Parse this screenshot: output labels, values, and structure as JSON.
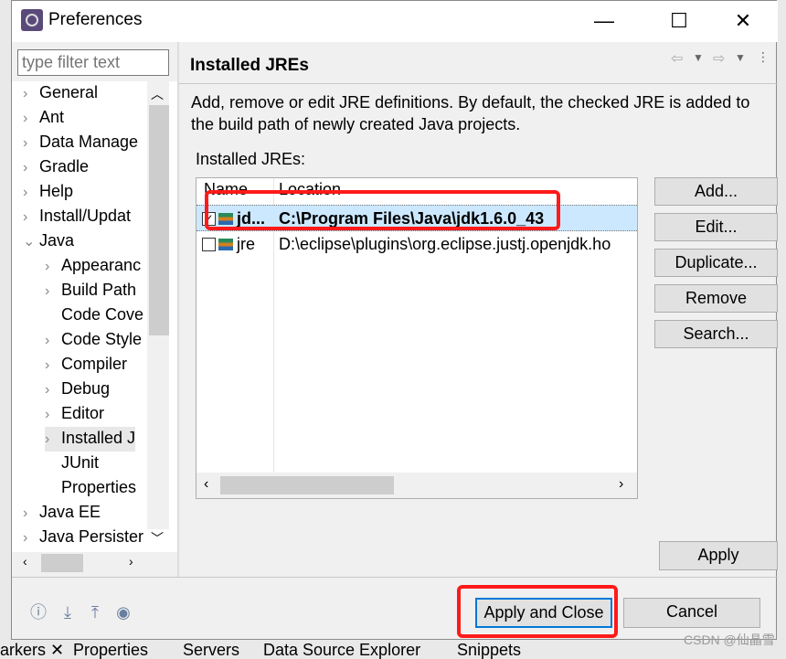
{
  "window": {
    "title": "Preferences",
    "minimize": "—",
    "maximize": "☐",
    "close": "✕"
  },
  "filter": {
    "placeholder": "type filter text"
  },
  "tree": [
    {
      "label": "General",
      "level": 0,
      "expander": "›"
    },
    {
      "label": "Ant",
      "level": 0,
      "expander": "›"
    },
    {
      "label": "Data Manage",
      "level": 0,
      "expander": "›"
    },
    {
      "label": "Gradle",
      "level": 0,
      "expander": "›"
    },
    {
      "label": "Help",
      "level": 0,
      "expander": "›"
    },
    {
      "label": "Install/Updat",
      "level": 0,
      "expander": "›"
    },
    {
      "label": "Java",
      "level": 0,
      "expander": "⌄"
    },
    {
      "label": "Appearanc",
      "level": 1,
      "expander": "›"
    },
    {
      "label": "Build Path",
      "level": 1,
      "expander": "›"
    },
    {
      "label": "Code Cove",
      "level": 1,
      "expander": ""
    },
    {
      "label": "Code Style",
      "level": 1,
      "expander": "›"
    },
    {
      "label": "Compiler",
      "level": 1,
      "expander": "›"
    },
    {
      "label": "Debug",
      "level": 1,
      "expander": "›"
    },
    {
      "label": "Editor",
      "level": 1,
      "expander": "›"
    },
    {
      "label": "Installed J",
      "level": 1,
      "expander": "›",
      "selected": true
    },
    {
      "label": "JUnit",
      "level": 1,
      "expander": ""
    },
    {
      "label": "Properties",
      "level": 1,
      "expander": ""
    },
    {
      "label": "Java EE",
      "level": 0,
      "expander": "›"
    },
    {
      "label": "Java Persister",
      "level": 0,
      "expander": "›"
    }
  ],
  "page": {
    "title": "Installed JREs",
    "description": "Add, remove or edit JRE definitions. By default, the checked JRE is added to the build path of newly created Java projects.",
    "table_label": "Installed JREs:",
    "columns": [
      "Name",
      "Location"
    ],
    "rows": [
      {
        "checked": true,
        "name": "jd...",
        "location": "C:\\Program Files\\Java\\jdk1.6.0_43",
        "bold": true
      },
      {
        "checked": false,
        "name": "jre",
        "location": "D:\\eclipse\\plugins\\org.eclipse.justj.openjdk.ho"
      }
    ],
    "buttons": [
      "Add...",
      "Edit...",
      "Duplicate...",
      "Remove",
      "Search..."
    ],
    "apply": "Apply"
  },
  "footer": {
    "apply_close": "Apply and Close",
    "cancel": "Cancel"
  },
  "taskbar": [
    "arkers ✕",
    "Properties",
    "Servers",
    "Data Source Explorer",
    "Snippets"
  ],
  "watermark": "CSDN @仙晶雪",
  "colors": {
    "highlight": "#ff1a1a",
    "selection": "#cce8ff",
    "focus": "#0078d7"
  }
}
